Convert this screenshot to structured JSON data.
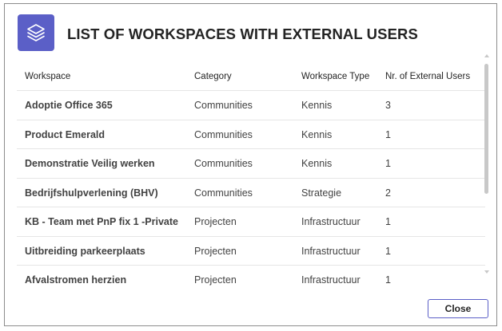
{
  "dialog": {
    "title": "LIST OF WORKSPACES WITH EXTERNAL USERS",
    "header_icon": "layers-icon",
    "accent_color": "#5b5fc7",
    "close_label": "Close"
  },
  "table": {
    "columns": [
      "Workspace",
      "Category",
      "Workspace Type",
      "Nr. of External Users"
    ],
    "rows": [
      [
        "Adoptie Office 365",
        "Communities",
        "Kennis",
        "3"
      ],
      [
        "Product Emerald",
        "Communities",
        "Kennis",
        "1"
      ],
      [
        "Demonstratie Veilig werken",
        "Communities",
        "Kennis",
        "1"
      ],
      [
        "Bedrijfshulpverlening (BHV)",
        "Communities",
        "Strategie",
        "2"
      ],
      [
        "KB - Team met PnP fix 1 -Private",
        "Projecten",
        "Infrastructuur",
        "1"
      ],
      [
        "Uitbreiding parkeerplaats",
        "Projecten",
        "Infrastructuur",
        "1"
      ],
      [
        "Afvalstromen herzien",
        "Projecten",
        "Infrastructuur",
        "1"
      ]
    ]
  }
}
